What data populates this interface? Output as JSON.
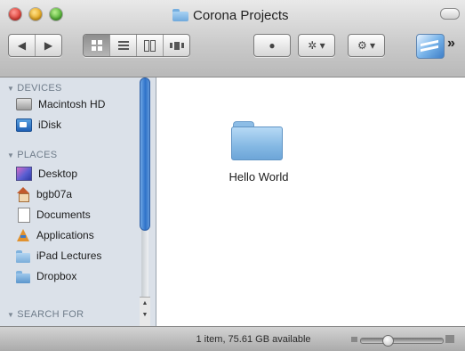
{
  "window": {
    "title": "Corona Projects"
  },
  "toolbar": {
    "back_label": "◀",
    "forward_label": "▶",
    "quick_look_label": "●",
    "action_label": "✲ ▾",
    "share_label": "⚙ ▾",
    "overflow_label": "»"
  },
  "sidebar": {
    "devices_header": "DEVICES",
    "places_header": "PLACES",
    "search_header": "SEARCH FOR",
    "devices": [
      {
        "label": "Macintosh HD",
        "icon": "hard-drive-icon"
      },
      {
        "label": "iDisk",
        "icon": "idisk-icon"
      }
    ],
    "places": [
      {
        "label": "Desktop",
        "icon": "desktop-icon"
      },
      {
        "label": "bgb07a",
        "icon": "home-icon"
      },
      {
        "label": "Documents",
        "icon": "document-icon"
      },
      {
        "label": "Applications",
        "icon": "applications-icon"
      },
      {
        "label": "iPad Lectures",
        "icon": "folder-icon"
      },
      {
        "label": "Dropbox",
        "icon": "dropbox-folder-icon"
      }
    ]
  },
  "content": {
    "items": [
      {
        "name": "Hello World",
        "icon": "folder-icon"
      }
    ]
  },
  "statusbar": {
    "text": "1 item, 75.61 GB available",
    "zoom_level": 0.3
  },
  "colors": {
    "sidebar_bg": "#dbe1e9",
    "selection_blue": "#2e72c9"
  }
}
